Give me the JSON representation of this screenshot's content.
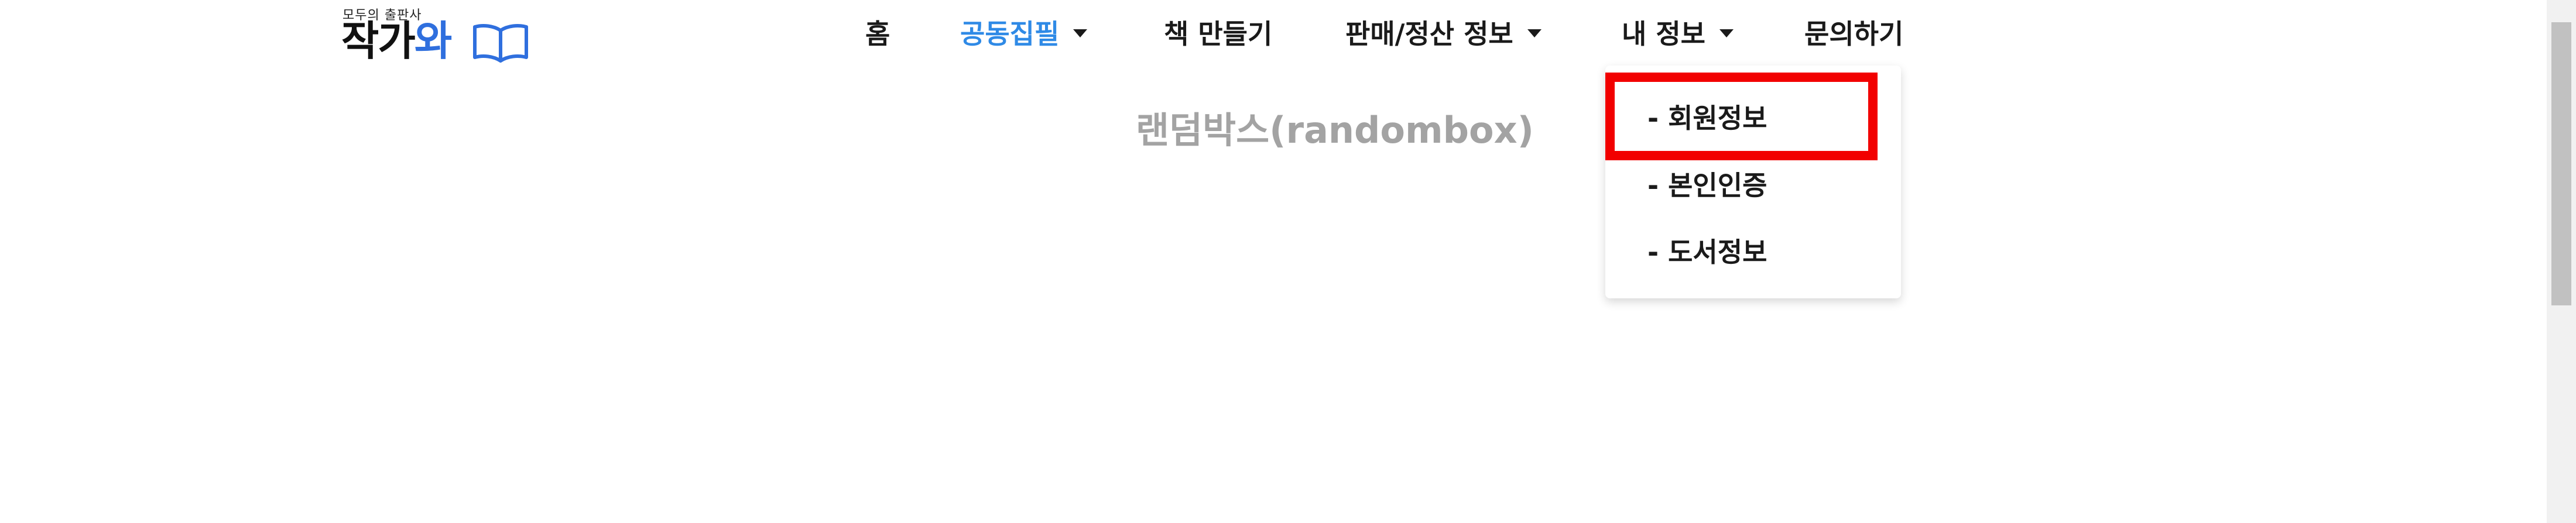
{
  "logo": {
    "tagline": "모두의 출판사",
    "name_part1": "작가",
    "name_part2": "와",
    "icon": "open-book-icon",
    "colors": {
      "dark": "#111111",
      "accent": "#2f6fde"
    }
  },
  "nav": {
    "items": [
      {
        "label": "홈",
        "has_dropdown": false,
        "active": false
      },
      {
        "label": "공동집필",
        "has_dropdown": true,
        "active": true
      },
      {
        "label": "책 만들기",
        "has_dropdown": false,
        "active": false
      },
      {
        "label": "판매/정산 정보",
        "has_dropdown": true,
        "active": false
      },
      {
        "label": "내 정보",
        "has_dropdown": true,
        "active": false
      },
      {
        "label": "문의하기",
        "has_dropdown": false,
        "active": false
      }
    ],
    "active_color": "#2f8ae6",
    "caret_icon": "caret-down-icon"
  },
  "page": {
    "title": "랜덤박스(randombox)"
  },
  "dropdown": {
    "items": [
      {
        "label": "- 회원정보",
        "highlighted": true
      },
      {
        "label": "- 본인인증",
        "highlighted": false
      },
      {
        "label": "- 도서정보",
        "highlighted": false
      }
    ],
    "highlight_color": "#f20000"
  }
}
